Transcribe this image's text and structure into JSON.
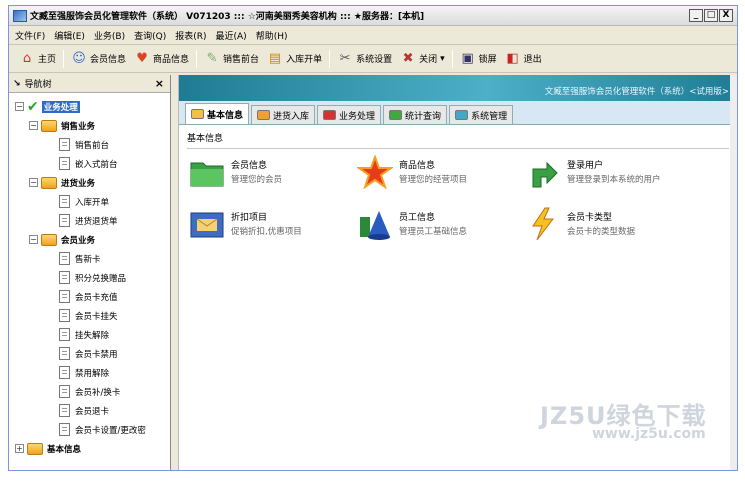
{
  "window": {
    "title": "文臧至强服饰会员化管理软件（系统） V071203 ::: ☆河南美丽秀美容机构 ::: ★服务器：[本机]",
    "controls": [
      "_",
      "□",
      "X"
    ]
  },
  "menu": [
    "文件(F)",
    "编辑(E)",
    "业务(B)",
    "查询(Q)",
    "报表(R)",
    "最近(A)",
    "帮助(H)"
  ],
  "toolbar": {
    "home": "主页",
    "member_info": "会员信息",
    "product_info": "商品信息",
    "sales_counter": "销售前台",
    "stock_in": "入库开单",
    "system_settings": "系统设置",
    "close": "关闭",
    "lock": "锁屏",
    "exit": "退出"
  },
  "nav": {
    "title": "导航树",
    "root": "业务处理",
    "groups": [
      {
        "label": "销售业务",
        "items": [
          "销售前台",
          "嵌入式前台"
        ]
      },
      {
        "label": "进货业务",
        "items": [
          "入库开单",
          "进货退货单"
        ]
      },
      {
        "label": "会员业务",
        "items": [
          "售新卡",
          "积分兑换赠品",
          "会员卡充值",
          "会员卡挂失",
          "挂失解除",
          "会员卡禁用",
          "禁用解除",
          "会员补/换卡",
          "会员退卡",
          "会员卡设置/更改密"
        ]
      }
    ],
    "bottom": "基本信息"
  },
  "banner": "文臧至强服饰会员化管理软件（系统）<试用版>",
  "tabs": [
    "基本信息",
    "进货入库",
    "业务处理",
    "统计查询",
    "系统管理"
  ],
  "panel_title": "基本信息",
  "items": [
    {
      "name": "会员信息",
      "desc": "管理您的会员"
    },
    {
      "name": "商品信息",
      "desc": "管理您的经营项目"
    },
    {
      "name": "登录用户",
      "desc": "管理登录到本系统的用户"
    },
    {
      "name": "折扣项目",
      "desc": "促销折扣,优惠项目"
    },
    {
      "name": "员工信息",
      "desc": "管理员工基础信息"
    },
    {
      "name": "会员卡类型",
      "desc": "会员卡的类型数据"
    }
  ],
  "watermark": {
    "line1": "JZ5U绿色下载",
    "line2": "www.jz5u.com"
  }
}
